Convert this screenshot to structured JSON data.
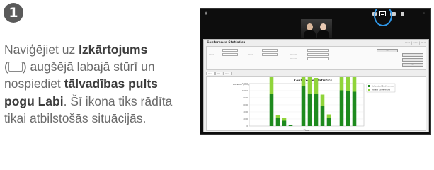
{
  "step_number": "1",
  "instruction": {
    "part1": "Naviģējiet uz ",
    "bold1": "Izkārtojums",
    "part2": " augšējā labajā stūrī un nospiediet ",
    "bold2": "tālvadības pults pogu Labi",
    "part3": ". Šī ikona tiks rādīta tikai atbilstošās situācijās.",
    "icon_name": "layout-icon"
  },
  "accent_color": "#2f97e8",
  "screenshot": {
    "window_title": "Conference Statistics",
    "chart_data": {
      "type": "bar",
      "title": "Conference Statistics",
      "xlabel": "Time",
      "ylabel": "Duration (min)",
      "series": [
        {
          "name": "Scheduled Conferences",
          "color": "#1e8a1e",
          "values": [
            0,
            0,
            0,
            9200,
            2300,
            1500,
            200,
            0,
            11200,
            9100,
            9000,
            5800,
            2200,
            0,
            10100,
            9900,
            9700,
            0
          ]
        },
        {
          "name": "Instant Conferences",
          "color": "#8fd43a",
          "values": [
            0,
            0,
            0,
            4600,
            900,
            700,
            100,
            0,
            5700,
            4800,
            4600,
            3100,
            1100,
            0,
            5200,
            5100,
            5000,
            0
          ]
        }
      ],
      "ylim": [
        0,
        12000
      ]
    }
  }
}
